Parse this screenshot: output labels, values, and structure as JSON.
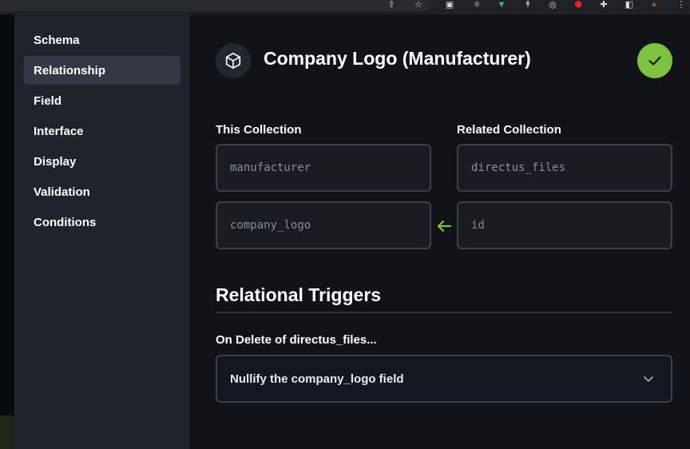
{
  "sidebar": {
    "items": [
      {
        "label": "Schema"
      },
      {
        "label": "Relationship"
      },
      {
        "label": "Field"
      },
      {
        "label": "Interface"
      },
      {
        "label": "Display"
      },
      {
        "label": "Validation"
      },
      {
        "label": "Conditions"
      }
    ],
    "active_index": 1
  },
  "header": {
    "title": "Company Logo (Manufacturer)",
    "icon": "cube-icon",
    "save_icon": "check-icon"
  },
  "relationship": {
    "this_collection_label": "This Collection",
    "related_collection_label": "Related Collection",
    "this_collection_value": "manufacturer",
    "this_field_value": "company_logo",
    "related_collection_value": "directus_files",
    "related_field_value": "id",
    "link_icon": "arrow-left-icon"
  },
  "triggers": {
    "section_title": "Relational Triggers",
    "on_delete_label": "On Delete of directus_files...",
    "on_delete_value": "Nullify the company_logo field"
  },
  "colors": {
    "accent": "#7dc33f",
    "sidebar_bg": "#1f242c",
    "main_bg": "#101318"
  }
}
